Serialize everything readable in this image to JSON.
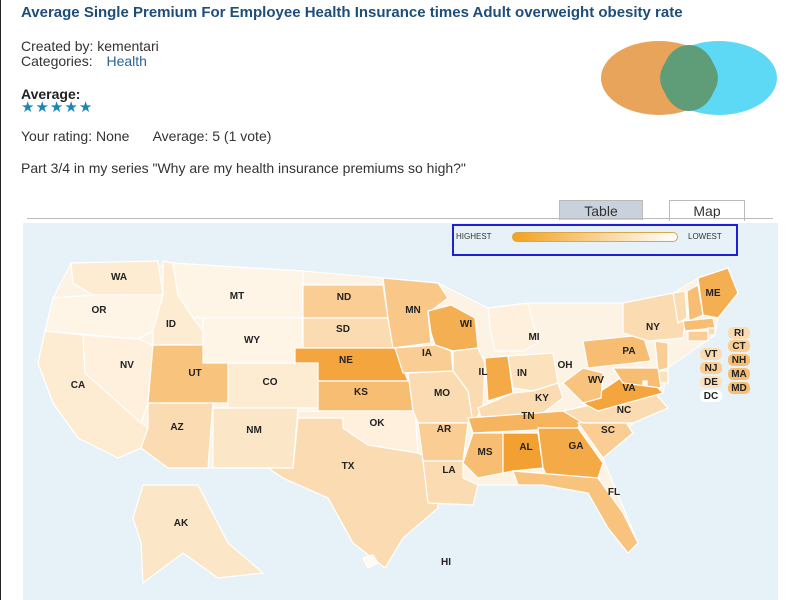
{
  "header": {
    "title": "Average Single Premium For Employee Health Insurance times Adult overweight obesity rate",
    "created_by_label": "Created by:",
    "created_by": "kementari",
    "categories_label": "Categories:",
    "category": "Health"
  },
  "rating": {
    "average_label": "Average:",
    "stars": 5,
    "your_rating": "Your rating: None",
    "average_text": "Average: 5 (1 vote)"
  },
  "description": "Part 3/4 in my series \"Why are my health insurance premiums so high?\"",
  "tabs": [
    {
      "label": "Table",
      "active": false
    },
    {
      "label": "Map",
      "active": true
    }
  ],
  "legend": {
    "high_label": "HIGHEST",
    "low_label": "LOWEST",
    "high_color": "#f2a21e",
    "low_color": "#ffffff"
  },
  "colors": {
    "title": "#1f4d7a",
    "star": "#1b87b7",
    "venn_left": "#e8a45a",
    "venn_right": "#5ed9f5",
    "venn_overlap": "#5f9c78",
    "map_background": "#e6f2f8"
  },
  "states": [
    {
      "code": "WA",
      "level": 0.15
    },
    {
      "code": "OR",
      "level": 0.05
    },
    {
      "code": "CA",
      "level": 0.15
    },
    {
      "code": "ID",
      "level": 0.15
    },
    {
      "code": "NV",
      "level": 0.1
    },
    {
      "code": "MT",
      "level": 0.05
    },
    {
      "code": "WY",
      "level": 0.05
    },
    {
      "code": "UT",
      "level": 0.55
    },
    {
      "code": "AZ",
      "level": 0.3
    },
    {
      "code": "CO",
      "level": 0.15
    },
    {
      "code": "NM",
      "level": 0.2
    },
    {
      "code": "ND",
      "level": 0.45
    },
    {
      "code": "SD",
      "level": 0.3
    },
    {
      "code": "NE",
      "level": 0.85
    },
    {
      "code": "KS",
      "level": 0.6
    },
    {
      "code": "OK",
      "level": 0.1
    },
    {
      "code": "TX",
      "level": 0.3
    },
    {
      "code": "MN",
      "level": 0.5
    },
    {
      "code": "IA",
      "level": 0.45
    },
    {
      "code": "MO",
      "level": 0.3
    },
    {
      "code": "AR",
      "level": 0.45
    },
    {
      "code": "LA",
      "level": 0.3
    },
    {
      "code": "WI",
      "level": 0.75
    },
    {
      "code": "IL",
      "level": 0.3
    },
    {
      "code": "MI",
      "level": 0.1
    },
    {
      "code": "IN",
      "level": 0.8
    },
    {
      "code": "OH",
      "level": 0.25
    },
    {
      "code": "KY",
      "level": 0.3
    },
    {
      "code": "TN",
      "level": 0.7
    },
    {
      "code": "MS",
      "level": 0.6
    },
    {
      "code": "AL",
      "level": 0.9
    },
    {
      "code": "GA",
      "level": 0.8
    },
    {
      "code": "FL",
      "level": 0.55
    },
    {
      "code": "SC",
      "level": 0.45
    },
    {
      "code": "NC",
      "level": 0.3
    },
    {
      "code": "VA",
      "level": 0.85
    },
    {
      "code": "WV",
      "level": 0.55
    },
    {
      "code": "PA",
      "level": 0.6
    },
    {
      "code": "NY",
      "level": 0.3
    },
    {
      "code": "ME",
      "level": 0.75
    },
    {
      "code": "VT",
      "level": 0.3
    },
    {
      "code": "NH",
      "level": 0.6
    },
    {
      "code": "MA",
      "level": 0.6
    },
    {
      "code": "RI",
      "level": 0.3
    },
    {
      "code": "CT",
      "level": 0.45
    },
    {
      "code": "NJ",
      "level": 0.45
    },
    {
      "code": "DE",
      "level": 0.25
    },
    {
      "code": "MD",
      "level": 0.6
    },
    {
      "code": "DC",
      "level": 0.0
    },
    {
      "code": "AK",
      "level": 0.2
    },
    {
      "code": "HI",
      "level": 0.0
    }
  ]
}
